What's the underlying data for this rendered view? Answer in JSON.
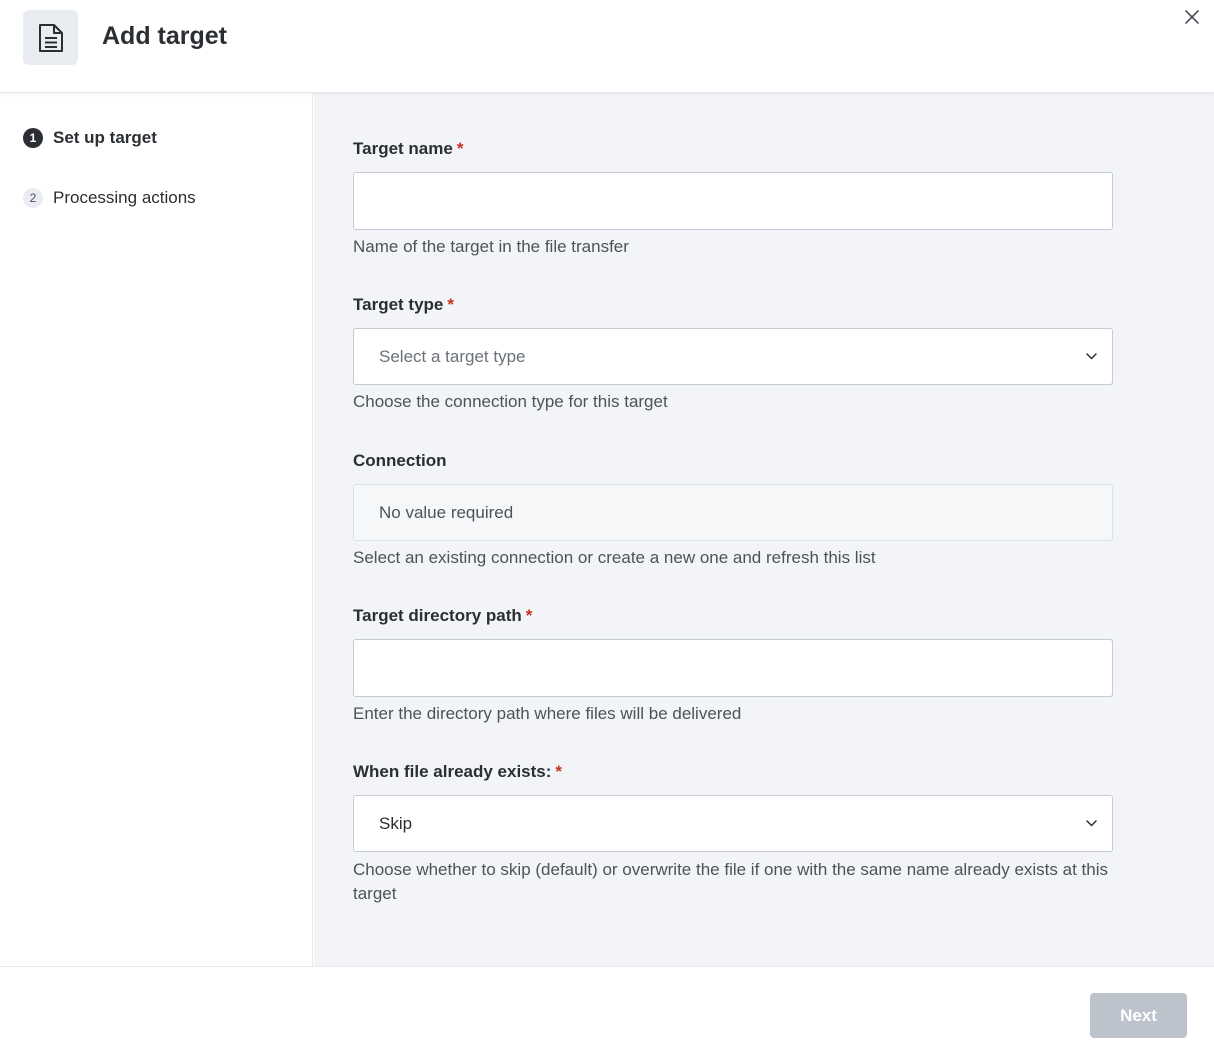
{
  "header": {
    "title": "Add target",
    "icon": "document-icon",
    "close_icon": "close-icon"
  },
  "steps": [
    {
      "number": "1",
      "label": "Set up target",
      "active": true
    },
    {
      "number": "2",
      "label": "Processing actions",
      "active": false
    }
  ],
  "form": {
    "target_name": {
      "label": "Target name",
      "required": "*",
      "value": "",
      "helper": "Name of the target in the file transfer"
    },
    "target_type": {
      "label": "Target type",
      "required": "*",
      "placeholder": "Select a target type",
      "helper": "Choose the connection type for this target"
    },
    "connection": {
      "label": "Connection",
      "value": "No value required",
      "helper": "Select an existing connection or create a new one and refresh this list"
    },
    "target_directory_path": {
      "label": "Target directory path",
      "required": "*",
      "value": "",
      "helper": "Enter the directory path where files will be delivered"
    },
    "file_exists": {
      "label": "When file already exists:",
      "required": "*",
      "value": "Skip",
      "helper": "Choose whether to skip (default) or overwrite the file if one with the same name already exists at this target"
    }
  },
  "footer": {
    "next_label": "Next"
  },
  "colors": {
    "required": "#c8301f",
    "main_bg": "#f2f4f8",
    "button_disabled": "#bcc3cc"
  }
}
